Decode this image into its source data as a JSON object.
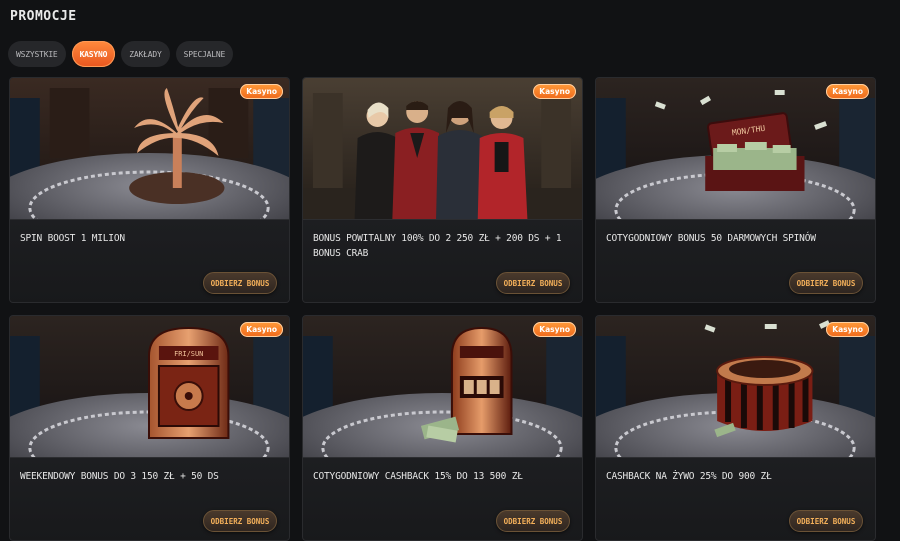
{
  "page": {
    "title": "PROMOCJE"
  },
  "tabs": [
    {
      "label": "WSZYSTKIE",
      "active": false
    },
    {
      "label": "KASYNO",
      "active": true
    },
    {
      "label": "ZAKŁADY",
      "active": false
    },
    {
      "label": "SPECJALNE",
      "active": false
    }
  ],
  "promotions": [
    {
      "badge": "Kasyno",
      "title": "SPIN BOOST 1 MILION",
      "button": "ODBIERZ BONUS",
      "art": "palm-tree-icon"
    },
    {
      "badge": "Kasyno",
      "title": "BONUS POWITALNY 100% DO 2 250 ZŁ + 200 DS + 1 BONUS CRAB",
      "button": "ODBIERZ BONUS",
      "art": "characters"
    },
    {
      "badge": "Kasyno",
      "title": "COTYGODNIOWY BONUS 50 DARMOWYCH SPINÓW",
      "button": "ODBIERZ BONUS",
      "art": "money-case",
      "prop_label": "MON/THU"
    },
    {
      "badge": "Kasyno",
      "title": "WEEKENDOWY BONUS DO 3 150 ZŁ + 50 DS",
      "button": "ODBIERZ BONUS",
      "art": "safe",
      "prop_label": "FRI/SUN"
    },
    {
      "badge": "Kasyno",
      "title": "COTYGODNIOWY CASHBACK 15% DO 13 500 ZŁ",
      "button": "ODBIERZ BONUS",
      "art": "slot-machine"
    },
    {
      "badge": "Kasyno",
      "title": "CASHBACK NA ŻYWO 25% DO 900 ZŁ",
      "button": "ODBIERZ BONUS",
      "art": "roulette-table"
    }
  ],
  "colors": {
    "accent": "#f06a1c",
    "button_text": "#f4b05a",
    "background": "#111214",
    "card": "#1b1c1f"
  }
}
